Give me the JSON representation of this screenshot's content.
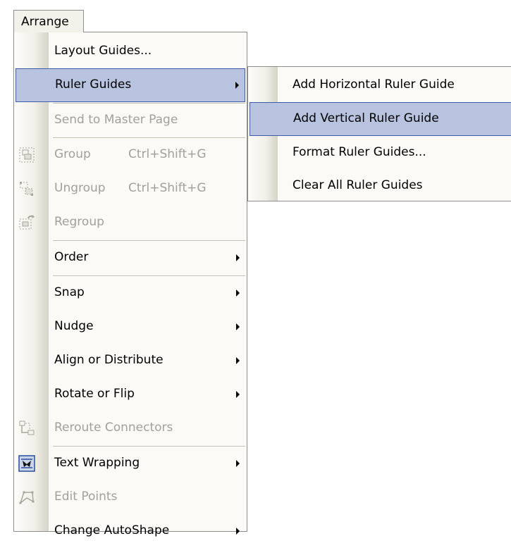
{
  "menubar": {
    "arrange_label": "Arrange"
  },
  "menu": {
    "items": [
      {
        "label": "Layout Guides...",
        "mnemonic": "L"
      },
      {
        "label": "Ruler Guides",
        "mnemonic": "d"
      },
      {
        "label": "Send to Master Page",
        "mnemonic": "M"
      },
      {
        "label": "Group",
        "shortcut": "Ctrl+Shift+G",
        "mnemonic": "G",
        "icon": "group-icon"
      },
      {
        "label": "Ungroup",
        "shortcut": "Ctrl+Shift+G",
        "mnemonic": "U",
        "icon": "ungroup-icon"
      },
      {
        "label": "Regroup",
        "mnemonic": "o",
        "icon": "regroup-icon"
      },
      {
        "label": "Order",
        "mnemonic": "r"
      },
      {
        "label": "Snap",
        "mnemonic": "S"
      },
      {
        "label": "Nudge",
        "mnemonic": "N"
      },
      {
        "label": "Align or Distribute",
        "mnemonic": "A"
      },
      {
        "label": "Rotate or Flip",
        "mnemonic": "p"
      },
      {
        "label": "Reroute Connectors",
        "mnemonic": "t",
        "icon": "reroute-connectors-icon"
      },
      {
        "label": "Text Wrapping",
        "mnemonic": "x",
        "icon": "text-wrapping-icon"
      },
      {
        "label": "Edit Points",
        "mnemonic": "E",
        "icon": "edit-points-icon"
      },
      {
        "label": "Change AutoShape",
        "mnemonic": "C"
      }
    ]
  },
  "submenu": {
    "items": [
      {
        "label": "Add Horizontal Ruler Guide",
        "mnemonic": "H"
      },
      {
        "label": "Add Vertical Ruler Guide",
        "mnemonic": "V"
      },
      {
        "label": "Format Ruler Guides...",
        "mnemonic": "F"
      },
      {
        "label": "Clear All Ruler Guides",
        "mnemonic": "C"
      }
    ]
  },
  "colors": {
    "highlight_fill": "#b7c3df",
    "highlight_border": "#3d5ba6",
    "disabled_text": "#a2a09a",
    "menu_background": "#fbfaf7"
  }
}
